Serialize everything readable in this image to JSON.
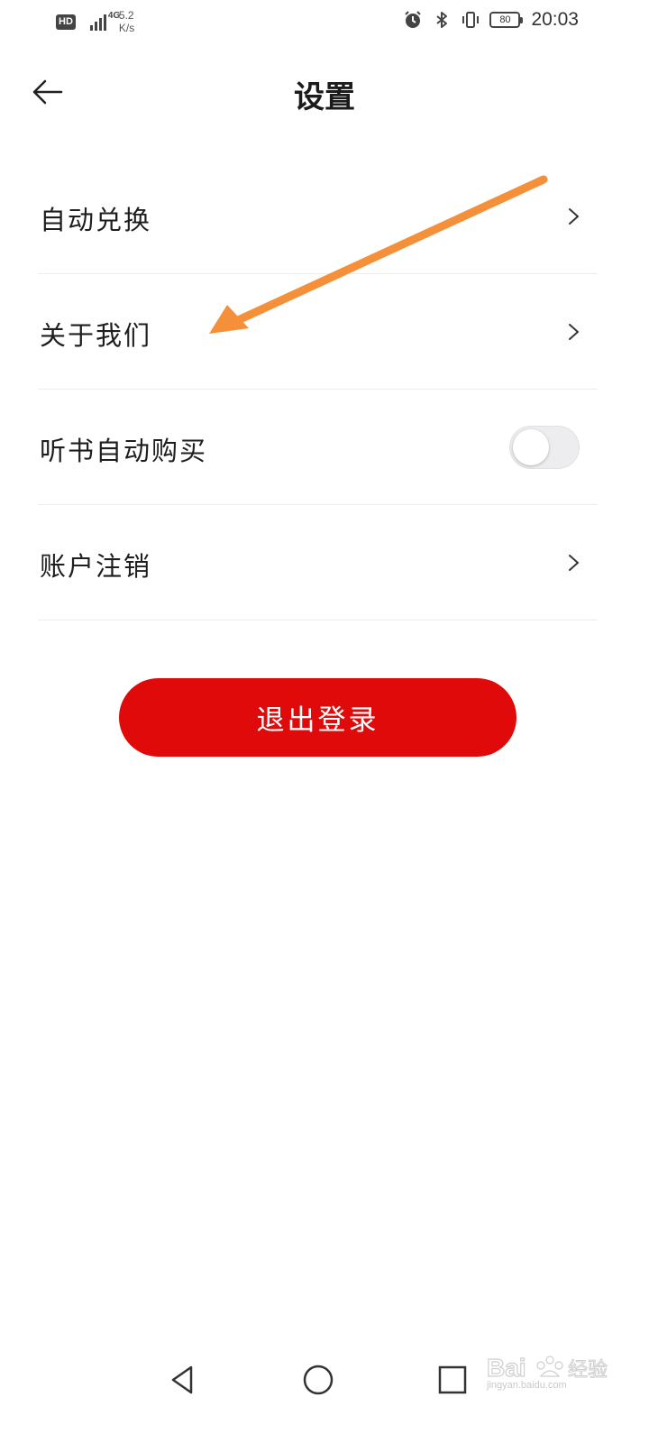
{
  "status_bar": {
    "hd": "HD",
    "network": "4G",
    "speed_value": "5.2",
    "speed_unit": "K/s",
    "battery": "80",
    "time": "20:03",
    "icons": [
      "alarm-icon",
      "bluetooth-icon",
      "vibrate-icon",
      "battery-icon"
    ]
  },
  "header": {
    "title": "设置",
    "back_icon": "arrow-left-icon"
  },
  "settings": {
    "items": [
      {
        "label": "自动兑换",
        "control": "chevron"
      },
      {
        "label": "关于我们",
        "control": "chevron"
      },
      {
        "label": "听书自动购买",
        "control": "toggle",
        "toggle_on": false
      },
      {
        "label": "账户注销",
        "control": "chevron"
      }
    ]
  },
  "logout": {
    "label": "退出登录",
    "color": "#e10a0a"
  },
  "annotation": {
    "arrow_color": "#f5903a"
  },
  "nav_bar": {
    "buttons": [
      "back-triangle-icon",
      "home-circle-icon",
      "recents-square-icon"
    ]
  },
  "watermark": {
    "brand": "Bai 经验",
    "url": "jingyan.baidu.com"
  }
}
